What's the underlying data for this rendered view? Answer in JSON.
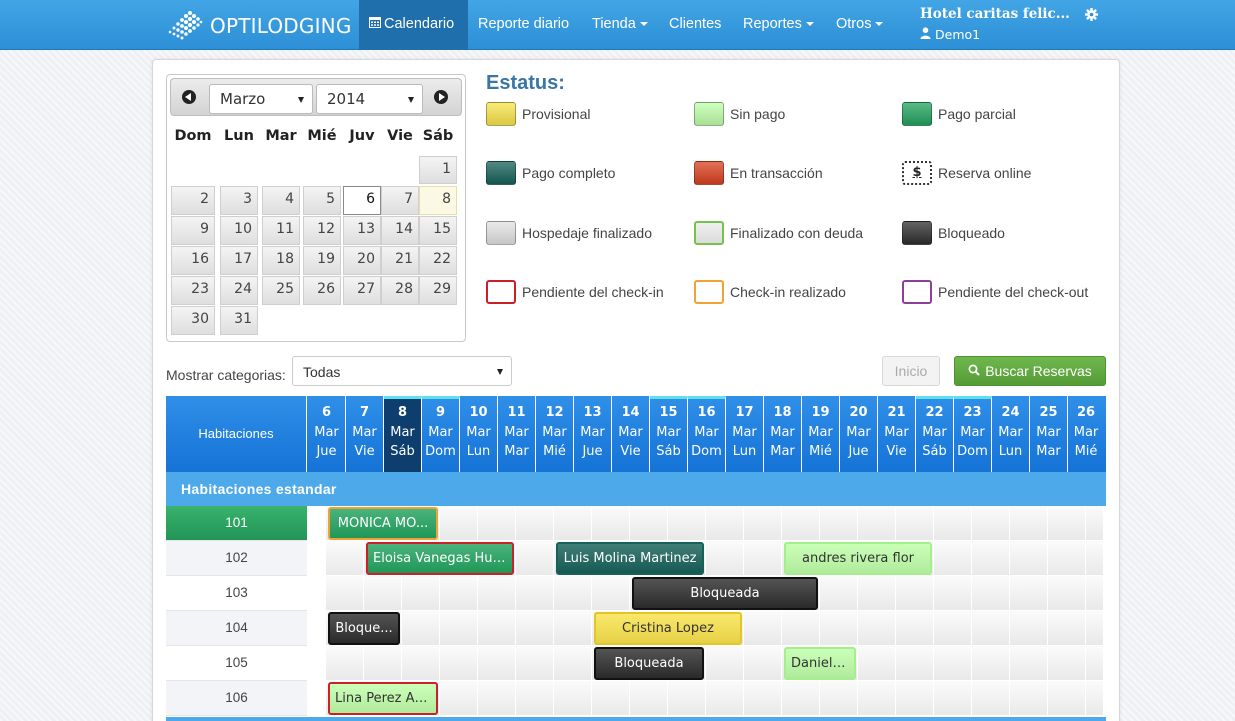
{
  "navbar": {
    "brand": "OPTILODGING",
    "items": [
      {
        "label": "Calendario",
        "icon": "calendar-icon",
        "active": true
      },
      {
        "label": "Reporte diario"
      },
      {
        "label": "Tienda",
        "dropdown": true
      },
      {
        "label": "Clientes"
      },
      {
        "label": "Reportes",
        "dropdown": true
      },
      {
        "label": "Otros",
        "dropdown": true
      }
    ],
    "hotel_name": "Hotel caritas felic...",
    "username": "Demo1",
    "settings_icon": "gear-icon",
    "user_icon": "user-icon"
  },
  "datepicker": {
    "month": "Marzo",
    "year": "2014",
    "weekdays": [
      "Dom",
      "Lun",
      "Mar",
      "Mié",
      "Juv",
      "Vie",
      "Sáb"
    ],
    "first_weekday_index": 6,
    "days_in_month": 31,
    "selected_day": "6",
    "today_day": "8",
    "prev_icon": "chevron-left-icon",
    "next_icon": "chevron-right-icon"
  },
  "status": {
    "title": "Estatus:",
    "items": [
      {
        "label": "Provisional",
        "style": "fill",
        "color": "#f9e34c"
      },
      {
        "label": "Sin pago",
        "style": "fill",
        "color": "#bfffa9"
      },
      {
        "label": "Pago parcial",
        "style": "fill",
        "color": "#22a35f"
      },
      {
        "label": "Pago completo",
        "style": "fill",
        "color": "#17615a"
      },
      {
        "label": "En transacción",
        "style": "fill",
        "color": "#d9411f"
      },
      {
        "label": "Reserva online",
        "style": "dollar",
        "symbol": "$"
      },
      {
        "label": "Hospedaje finalizado",
        "style": "fill",
        "color": "#e2e2e2"
      },
      {
        "label": "Finalizado con deuda",
        "style": "outline-fill",
        "color": "#78c14d"
      },
      {
        "label": "Bloqueado",
        "style": "fill",
        "color": "#2e2e2e"
      },
      {
        "label": "Pendiente del check-in",
        "style": "outline",
        "color": "#cc1f27"
      },
      {
        "label": "Check-in realizado",
        "style": "outline",
        "color": "#f0a332"
      },
      {
        "label": "Pendiente del check-out",
        "style": "outline",
        "color": "#8e3f9e"
      }
    ]
  },
  "filters": {
    "categories_label": "Mostrar categorias:",
    "categories_value": "Todas",
    "inicio_label": "Inicio",
    "buscar_label": "Buscar Reservas",
    "search_icon": "search-icon"
  },
  "grid": {
    "rooms_header": "Habitaciones",
    "month_abbr": "Mar",
    "current_day": "8",
    "days": [
      {
        "num": "6",
        "dow": "Jue"
      },
      {
        "num": "7",
        "dow": "Vie"
      },
      {
        "num": "8",
        "dow": "Sáb"
      },
      {
        "num": "9",
        "dow": "Dom"
      },
      {
        "num": "10",
        "dow": "Lun"
      },
      {
        "num": "11",
        "dow": "Mar"
      },
      {
        "num": "12",
        "dow": "Mié"
      },
      {
        "num": "13",
        "dow": "Jue"
      },
      {
        "num": "14",
        "dow": "Vie"
      },
      {
        "num": "15",
        "dow": "Sáb"
      },
      {
        "num": "16",
        "dow": "Dom"
      },
      {
        "num": "17",
        "dow": "Lun"
      },
      {
        "num": "18",
        "dow": "Mar"
      },
      {
        "num": "19",
        "dow": "Mié"
      },
      {
        "num": "20",
        "dow": "Jue"
      },
      {
        "num": "21",
        "dow": "Vie"
      },
      {
        "num": "22",
        "dow": "Sáb"
      },
      {
        "num": "23",
        "dow": "Dom"
      },
      {
        "num": "24",
        "dow": "Lun"
      },
      {
        "num": "25",
        "dow": "Mar"
      },
      {
        "num": "26",
        "dow": "Mié"
      }
    ],
    "category_name": "Habitaciones estandar",
    "rooms": [
      "101",
      "102",
      "103",
      "104",
      "105",
      "106"
    ],
    "reservations": [
      {
        "room": "101",
        "name": "MONICA MO...",
        "start": "6",
        "end": "8",
        "bg": "#22a35f",
        "border": "#f0a332",
        "text": "#ffffff"
      },
      {
        "room": "102",
        "name": "Eloisa Vanegas Hur...",
        "start": "7",
        "end": "10",
        "bg": "#22a35f",
        "border": "#cc1f27",
        "text": "#ffffff"
      },
      {
        "room": "102",
        "name": "Luis Molina Martinez",
        "start": "12",
        "end": "15",
        "bg": "#17615a",
        "border": "#17615a",
        "text": "#ffffff"
      },
      {
        "room": "102",
        "name": "andres rivera flor",
        "start": "18",
        "end": "21",
        "bg": "#bfffa9",
        "border": "#a5ee8c",
        "text": "#333333"
      },
      {
        "room": "103",
        "name": "Bloqueada",
        "start": "14",
        "end": "18",
        "bg": "#2e2e2e",
        "border": "#111111",
        "text": "#ffffff"
      },
      {
        "room": "104",
        "name": "Bloque...",
        "start": "6",
        "end": "7",
        "bg": "#2e2e2e",
        "border": "#111111",
        "text": "#ffffff"
      },
      {
        "room": "104",
        "name": "Cristina Lopez",
        "start": "13",
        "end": "16",
        "bg": "#f9e34c",
        "border": "#e3c523",
        "text": "#333333"
      },
      {
        "room": "105",
        "name": "Bloqueada",
        "start": "13",
        "end": "15",
        "bg": "#2e2e2e",
        "border": "#111111",
        "text": "#ffffff"
      },
      {
        "room": "105",
        "name": "Daniela...",
        "start": "18",
        "end": "19",
        "bg": "#bfffa9",
        "border": "#a5ee8c",
        "text": "#333333"
      },
      {
        "room": "106",
        "name": "Lina Perez Ag...",
        "start": "6",
        "end": "8",
        "bg": "#bfffa9",
        "border": "#cc1f27",
        "text": "#333333"
      }
    ]
  }
}
